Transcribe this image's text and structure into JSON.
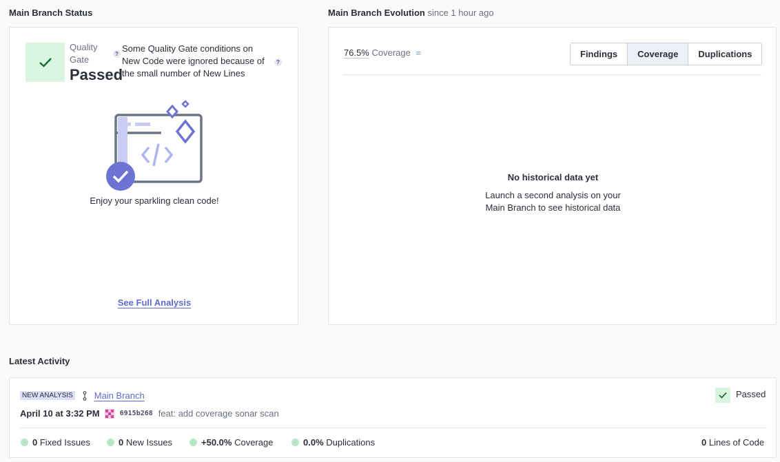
{
  "status": {
    "title": "Main Branch Status",
    "quality_gate_label": "Quality Gate",
    "quality_gate_value": "Passed",
    "note": "Some Quality Gate conditions on New Code were ignored because of the small number of New Lines",
    "help": "?",
    "message": "Enjoy your sparkling clean code!",
    "see_full_analysis": "See Full Analysis"
  },
  "evolution": {
    "title": "Main Branch Evolution",
    "since": "since 1 hour ago",
    "coverage_value": "76.5%",
    "coverage_label": "Coverage",
    "tabs": [
      {
        "label": "Findings",
        "active": false
      },
      {
        "label": "Coverage",
        "active": true
      },
      {
        "label": "Duplications",
        "active": false
      }
    ],
    "empty_title": "No historical data yet",
    "empty_line1": "Launch a second analysis on your",
    "empty_line2": "Main Branch to see historical data"
  },
  "activity": {
    "title": "Latest Activity",
    "badge": "NEW ANALYSIS",
    "branch": "Main Branch",
    "status": "Passed",
    "date": "April 10 at 3:32 PM",
    "commit_hash": "6915b268",
    "commit_message": "feat: add coverage sonar scan",
    "metrics": [
      {
        "value": "0",
        "label": "Fixed Issues"
      },
      {
        "value": "0",
        "label": "New Issues"
      },
      {
        "value": "+50.0%",
        "label": "Coverage"
      },
      {
        "value": "0.0%",
        "label": "Duplications"
      }
    ],
    "loc_value": "0",
    "loc_label": "Lines of Code"
  },
  "colors": {
    "accent": "#5d6cd0",
    "passed_bg": "#d9f5df",
    "passed_check": "#1b6b34",
    "metric_dot": "#b7e7c4"
  }
}
